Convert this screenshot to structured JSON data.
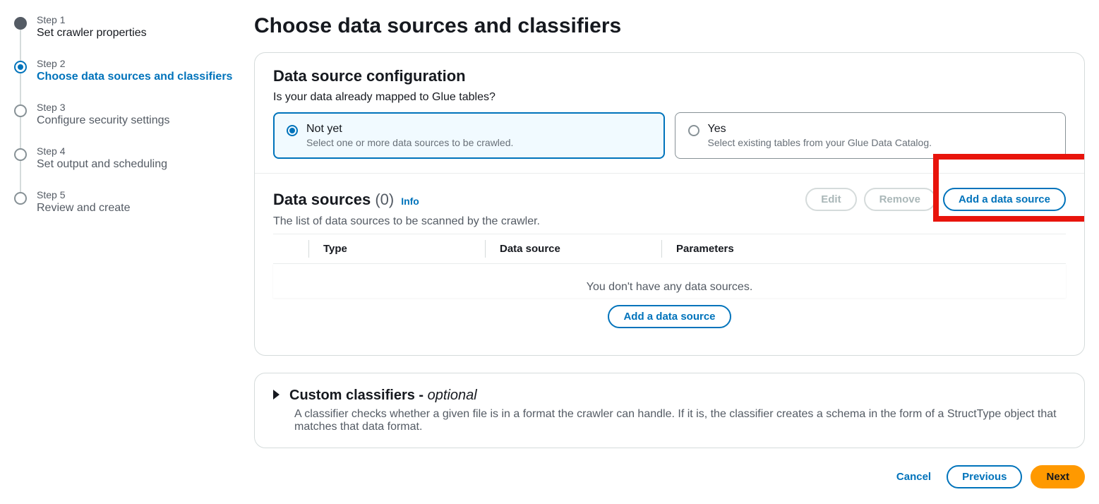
{
  "stepper": {
    "steps": [
      {
        "num": "Step 1",
        "label": "Set crawler properties"
      },
      {
        "num": "Step 2",
        "label": "Choose data sources and classifiers"
      },
      {
        "num": "Step 3",
        "label": "Configure security settings"
      },
      {
        "num": "Step 4",
        "label": "Set output and scheduling"
      },
      {
        "num": "Step 5",
        "label": "Review and create"
      }
    ]
  },
  "page": {
    "title": "Choose data sources and classifiers"
  },
  "config": {
    "title": "Data source configuration",
    "question": "Is your data already mapped to Glue tables?",
    "opt_notyet": {
      "label": "Not yet",
      "desc": "Select one or more data sources to be crawled."
    },
    "opt_yes": {
      "label": "Yes",
      "desc": "Select existing tables from your Glue Data Catalog."
    }
  },
  "datasources": {
    "title": "Data sources",
    "count": "(0)",
    "info": "Info",
    "desc": "The list of data sources to be scanned by the crawler.",
    "actions": {
      "edit": "Edit",
      "remove": "Remove",
      "add": "Add a data source"
    },
    "columns": {
      "type": "Type",
      "source": "Data source",
      "params": "Parameters"
    },
    "empty": "You don't have any data sources.",
    "empty_cta": "Add a data source"
  },
  "classifiers": {
    "title": "Custom classifiers -",
    "optional": "optional",
    "desc": "A classifier checks whether a given file is in a format the crawler can handle. If it is, the classifier creates a schema in the form of a StructType object that matches that data format."
  },
  "footer": {
    "cancel": "Cancel",
    "previous": "Previous",
    "next": "Next"
  }
}
